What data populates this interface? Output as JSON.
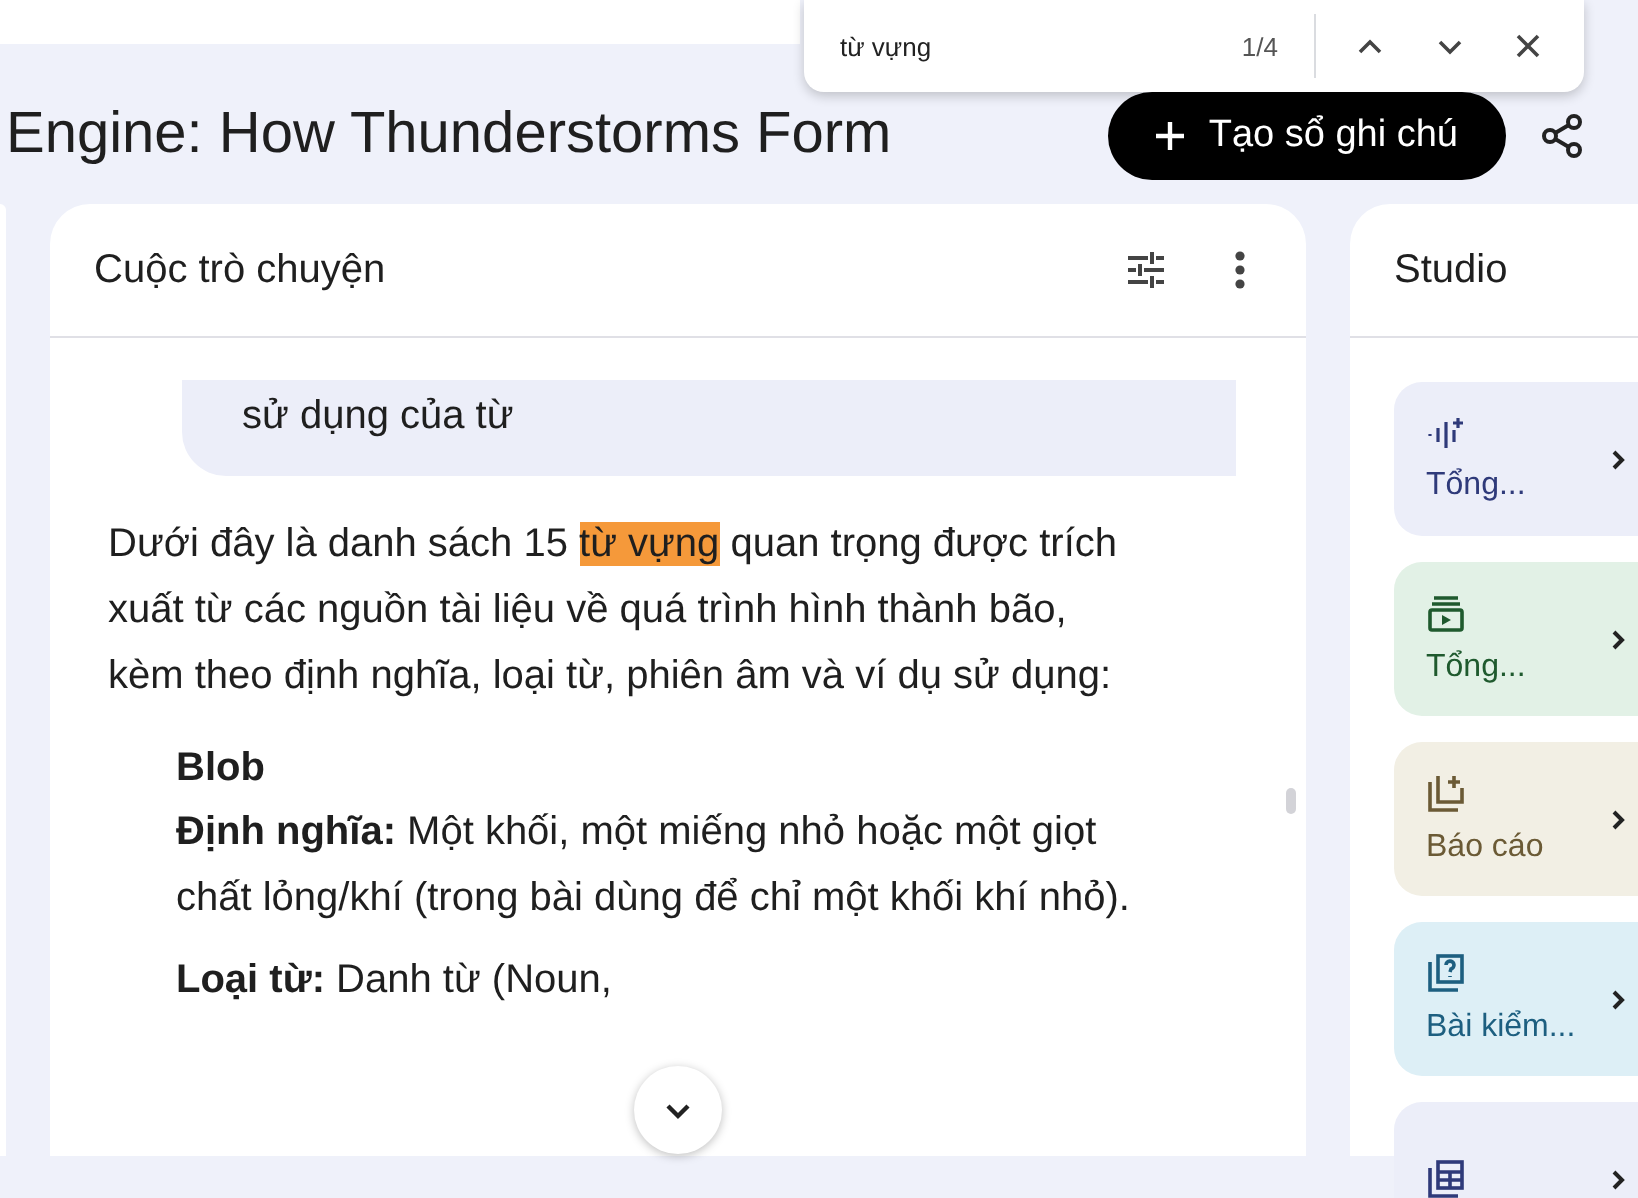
{
  "find_bar": {
    "query": "từ vựng",
    "count": "1/4"
  },
  "header": {
    "title": "Engine: How Thunderstorms Form",
    "create_button": "Tạo sổ ghi chú"
  },
  "chat": {
    "title": "Cuộc trò chuyện",
    "user_message": "sử dụng của từ",
    "intro": {
      "before": "Dưới đây là danh sách 15 ",
      "match": "từ vựng",
      "after": " quan trọng được trích xuất từ các nguồn tài liệu về quá trình hình thành bão, kèm theo định nghĩa, loại từ, phiên âm và ví dụ sử dụng:"
    },
    "term": "Blob",
    "fields": [
      {
        "text": "**Định nghĩa:** Một khối, một miếng nhỏ hoặc một giọt chất lỏng/khí (trong bài dùng để chỉ một khối khí nhỏ)."
      },
      {
        "text": "**Loại từ:** Danh từ (Noun,"
      }
    ]
  },
  "studio": {
    "title": "Studio",
    "items": [
      {
        "kind": "audio",
        "label": "Tổng..."
      },
      {
        "kind": "video",
        "label": "Tổng..."
      },
      {
        "kind": "report",
        "label": "Báo cáo"
      },
      {
        "kind": "quiz",
        "label": "Bài kiểm..."
      },
      {
        "kind": "table"
      }
    ]
  }
}
